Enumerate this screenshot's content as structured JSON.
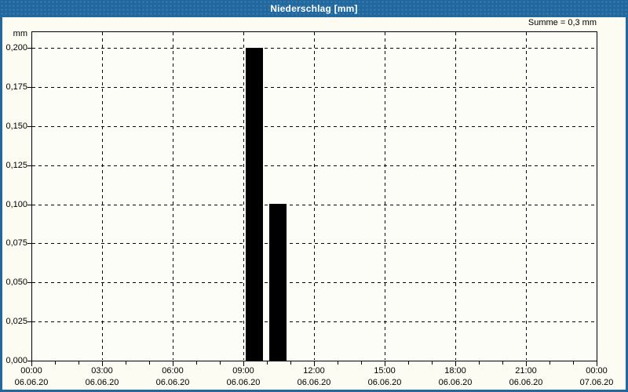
{
  "window": {
    "title": "Niederschlag [mm]"
  },
  "summary_label": "Summe = 0,3 mm",
  "colors": {
    "title_bar": "#20689E",
    "title_text": "#FFFFFF",
    "window_border": "#20689E",
    "background": "#FCFCF2",
    "plot_background": "#FDFDF8",
    "grid": "#000000",
    "axis": "#000000",
    "bar": "#000000"
  },
  "chart_data": {
    "type": "bar",
    "title": "Niederschlag [mm]",
    "ylabel": "mm",
    "xlabel": "",
    "ylim": [
      0,
      0.21
    ],
    "grid": "dashed",
    "legend": "none",
    "sum_annotation": "Summe = 0,3 mm",
    "y_ticks": [
      {
        "value": 0.0,
        "label": "0,000"
      },
      {
        "value": 0.025,
        "label": "0,025"
      },
      {
        "value": 0.05,
        "label": "0,050"
      },
      {
        "value": 0.075,
        "label": "0,075"
      },
      {
        "value": 0.1,
        "label": "0,100"
      },
      {
        "value": 0.125,
        "label": "0,125"
      },
      {
        "value": 0.15,
        "label": "0,150"
      },
      {
        "value": 0.175,
        "label": "0,175"
      },
      {
        "value": 0.2,
        "label": "0,200"
      }
    ],
    "x_hours_total": 24,
    "x_minor_step_hours": 1,
    "x_major_ticks": [
      {
        "hour": 0,
        "time": "00:00",
        "date": "06.06.20"
      },
      {
        "hour": 3,
        "time": "03:00",
        "date": "06.06.20"
      },
      {
        "hour": 6,
        "time": "06:00",
        "date": "06.06.20"
      },
      {
        "hour": 9,
        "time": "09:00",
        "date": "06.06.20"
      },
      {
        "hour": 12,
        "time": "12:00",
        "date": "06.06.20"
      },
      {
        "hour": 15,
        "time": "15:00",
        "date": "06.06.20"
      },
      {
        "hour": 18,
        "time": "18:00",
        "date": "06.06.20"
      },
      {
        "hour": 21,
        "time": "21:00",
        "date": "06.06.20"
      },
      {
        "hour": 24,
        "time": "00:00",
        "date": "07.06.20"
      }
    ],
    "bars": [
      {
        "interval": "09:00-10:00",
        "start_hour": 9,
        "end_hour": 10,
        "value": 0.2
      },
      {
        "interval": "10:00-11:00",
        "start_hour": 10,
        "end_hour": 11,
        "value": 0.1
      }
    ]
  }
}
